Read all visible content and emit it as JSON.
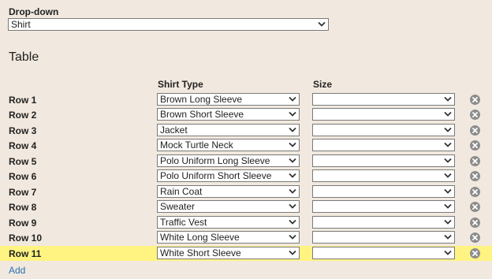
{
  "dropdown": {
    "label": "Drop-down",
    "selected": "Shirt"
  },
  "table": {
    "title": "Table",
    "columns": {
      "shirt_type": "Shirt Type",
      "size": "Size"
    },
    "highlight_color": "#fff382",
    "rows": [
      {
        "label": "Row 1",
        "shirt_type": "Brown Long Sleeve",
        "size": ""
      },
      {
        "label": "Row 2",
        "shirt_type": "Brown Short Sleeve",
        "size": ""
      },
      {
        "label": "Row 3",
        "shirt_type": "Jacket",
        "size": ""
      },
      {
        "label": "Row 4",
        "shirt_type": "Mock Turtle Neck",
        "size": ""
      },
      {
        "label": "Row 5",
        "shirt_type": "Polo Uniform Long Sleeve",
        "size": ""
      },
      {
        "label": "Row 6",
        "shirt_type": "Polo Uniform Short Sleeve",
        "size": ""
      },
      {
        "label": "Row 7",
        "shirt_type": "Rain Coat",
        "size": ""
      },
      {
        "label": "Row 8",
        "shirt_type": "Sweater",
        "size": ""
      },
      {
        "label": "Row 9",
        "shirt_type": "Traffic Vest",
        "size": ""
      },
      {
        "label": "Row 10",
        "shirt_type": "White Long Sleeve",
        "size": ""
      },
      {
        "label": "Row 11",
        "shirt_type": "White Short Sleeve",
        "size": "",
        "highlighted": true
      }
    ]
  },
  "actions": {
    "add_label": "Add"
  },
  "icons": {
    "dropdown_arrow": "chevron-down-icon",
    "remove": "remove-circle-icon"
  }
}
